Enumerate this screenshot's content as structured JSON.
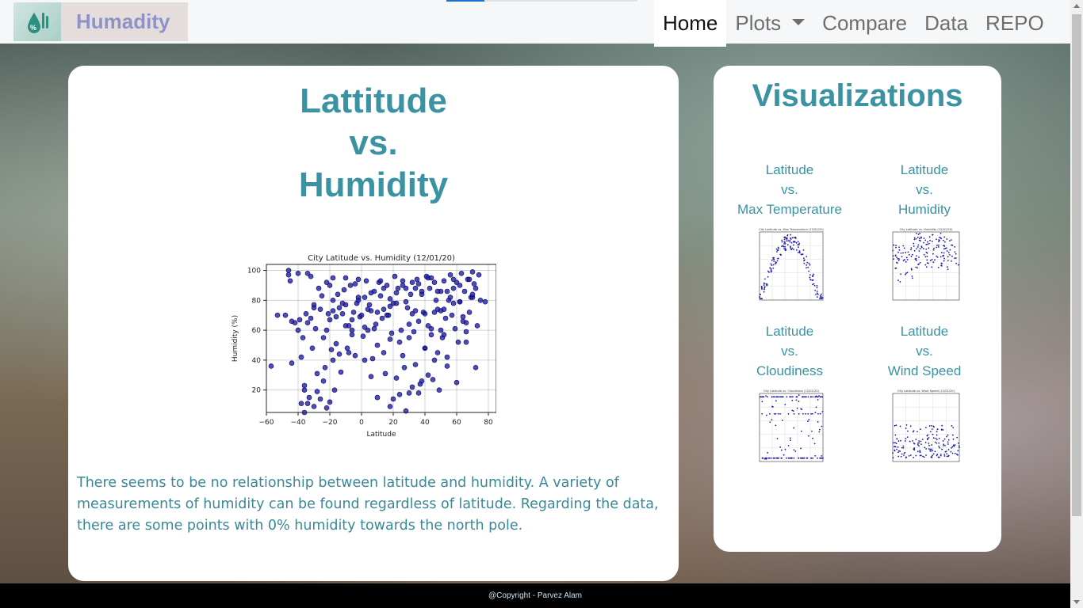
{
  "brand": {
    "name": "Humadity",
    "logo_icon": "humidity-drop-icon"
  },
  "nav": {
    "items": [
      {
        "label": "Home",
        "active": true
      },
      {
        "label": "Plots",
        "dropdown": true
      },
      {
        "label": "Compare"
      },
      {
        "label": "Data"
      },
      {
        "label": "REPO"
      }
    ]
  },
  "main": {
    "title_lines": [
      "Lattitude",
      "vs.",
      "Humidity"
    ],
    "description": "There seems to be no relationship between latitude and humidity. A variety of measurements of humidity can be found regardless of latitude. Regarding the data, there are some points with 0% humidity towards the north pole."
  },
  "visualizations": {
    "title": "Visualizations",
    "items": [
      {
        "lines": [
          "Latitude",
          "vs.",
          "Max Temperature"
        ],
        "thumb_title": "City Latitude vs. Max Temperature (12/01/20)"
      },
      {
        "lines": [
          "Latitude",
          "vs.",
          "Humidity"
        ],
        "thumb_title": "City Latitude vs. Humidity (12/01/20)"
      },
      {
        "lines": [
          "Latitude",
          "vs.",
          "Cloudiness"
        ],
        "thumb_title": "City Latitude vs. Cloudiness (12/01/20)"
      },
      {
        "lines": [
          "Latitude",
          "vs.",
          "Wind Speed"
        ],
        "thumb_title": "City Latitude vs. Wind Speed (12/01/20)"
      }
    ]
  },
  "footer": {
    "text": "@Copyright - Parvez Alam"
  },
  "colors": {
    "accent": "#3a92a3",
    "point": "#1c1aa8"
  },
  "chart_data": {
    "type": "scatter",
    "title": "City Latitude vs. Humidity (12/01/20)",
    "xlabel": "Latitude",
    "ylabel": "Humidity (%)",
    "xlim": [
      -60,
      85
    ],
    "ylim": [
      5,
      104
    ],
    "xticks": [
      -60,
      -40,
      -20,
      0,
      20,
      40,
      60,
      80
    ],
    "yticks": [
      20,
      40,
      60,
      80,
      100
    ],
    "grid": true,
    "x": [
      -57,
      -53,
      -48,
      -46,
      -45,
      -44,
      -42,
      -40,
      -39,
      -38,
      -37,
      -36,
      -35,
      -34,
      -33,
      -32,
      -31,
      -30,
      -29,
      -28,
      -27,
      -26,
      -25,
      -24,
      -23,
      -22,
      -21,
      -20,
      -19,
      -18,
      -17,
      -16,
      -15,
      -14,
      -13,
      -12,
      -11,
      -10,
      -9,
      -8,
      -7,
      -6,
      -5,
      -4,
      -3,
      -2,
      -1,
      0,
      1,
      2,
      3,
      4,
      5,
      6,
      7,
      8,
      9,
      10,
      11,
      12,
      13,
      14,
      15,
      16,
      17,
      18,
      19,
      20,
      21,
      22,
      23,
      24,
      25,
      26,
      27,
      28,
      29,
      30,
      31,
      32,
      33,
      34,
      35,
      36,
      37,
      38,
      39,
      40,
      41,
      42,
      43,
      44,
      45,
      46,
      47,
      48,
      49,
      50,
      51,
      52,
      53,
      54,
      55,
      56,
      57,
      58,
      59,
      60,
      61,
      62,
      63,
      64,
      65,
      66,
      67,
      68,
      69,
      70,
      71,
      72,
      73,
      74,
      75,
      78,
      -46,
      -44,
      -40,
      -36,
      -34,
      -30,
      -28,
      -24,
      -22,
      -20,
      -18,
      -16,
      -12,
      -10,
      -8,
      -6,
      -4,
      -2,
      2,
      4,
      6,
      8,
      10,
      12,
      14,
      16,
      18,
      22,
      24,
      26,
      28,
      30,
      32,
      34,
      36,
      38,
      40,
      42,
      44,
      46,
      48,
      50,
      52,
      54,
      56,
      58,
      60,
      62,
      64,
      66,
      68,
      70,
      72,
      -38,
      -36,
      -32,
      -30,
      -26,
      -22,
      -18,
      -14,
      -10,
      -6,
      -2,
      2,
      6,
      10,
      14,
      18,
      20,
      26,
      30,
      34,
      38,
      42,
      46,
      50,
      54,
      58,
      62,
      66,
      70,
      -34,
      -20,
      -18,
      18,
      22,
      28,
      32,
      36,
      40,
      44,
      48,
      52
    ],
    "y": [
      36,
      70,
      70,
      97,
      93,
      38,
      65,
      98,
      67,
      42,
      55,
      20,
      71,
      65,
      15,
      96,
      48,
      77,
      61,
      19,
      88,
      74,
      83,
      55,
      35,
      60,
      71,
      90,
      47,
      95,
      20,
      69,
      84,
      44,
      32,
      71,
      87,
      77,
      48,
      63,
      90,
      57,
      72,
      43,
      78,
      94,
      69,
      70,
      56,
      82,
      93,
      60,
      77,
      73,
      41,
      86,
      64,
      50,
      92,
      83,
      68,
      74,
      31,
      90,
      70,
      81,
      58,
      14,
      96,
      78,
      88,
      52,
      60,
      93,
      35,
      79,
      75,
      18,
      84,
      71,
      59,
      88,
      94,
      66,
      24,
      84,
      72,
      48,
      96,
      63,
      88,
      57,
      27,
      92,
      80,
      74,
      20,
      86,
      55,
      93,
      68,
      42,
      80,
      97,
      70,
      88,
      61,
      92,
      52,
      79,
      98,
      69,
      86,
      65,
      94,
      72,
      82,
      99,
      91,
      88,
      63,
      97,
      80,
      79,
      100,
      66,
      60,
      23,
      11,
      9,
      31,
      26,
      8,
      12,
      40,
      51,
      78,
      63,
      45,
      67,
      91,
      80,
      62,
      74,
      85,
      61,
      72,
      93,
      45,
      70,
      9,
      28,
      17,
      43,
      6,
      55,
      22,
      37,
      18,
      26,
      48,
      30,
      61,
      40,
      45,
      73,
      57,
      36,
      82,
      94,
      25,
      79,
      66,
      52,
      94,
      82,
      35,
      11,
      5,
      68,
      75,
      14,
      92,
      80,
      75,
      95,
      60,
      82,
      40,
      29,
      15,
      88,
      54,
      78,
      90,
      64,
      73,
      86,
      95,
      72,
      60,
      86,
      78,
      90,
      59,
      84,
      98,
      67,
      73,
      76,
      85,
      88,
      92,
      91,
      71,
      95,
      86,
      74,
      90,
      98
    ]
  }
}
